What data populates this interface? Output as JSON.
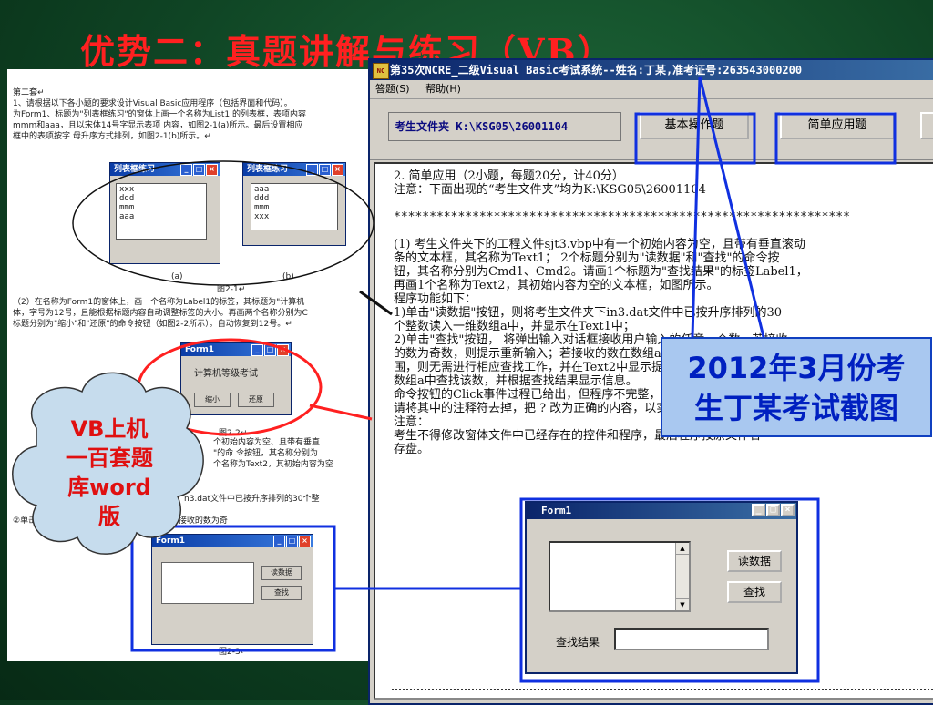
{
  "slide": {
    "title": "优势二：真题讲解与练习（VB）",
    "callout_blue": [
      "2012年3月份考",
      "生丁某考试截图"
    ],
    "cloud_text": [
      "VB上机",
      "一百套题",
      "库word",
      "版"
    ]
  },
  "doc": {
    "lines": [
      "第二套↵",
      "1、请根据以下各小题的要求设计Visual Basic应用程序（包括界面和代码）。",
      "为Form1、标题为\"列表框练习\"的窗体上画一个名称为List1 的列表框，表项内容",
      "mmm和aaa，且以宋体14号字显示表项 内容，如图2-1(a)所示。最后设置相应",
      "框中的表项按字 母升序方式排列，如图2-1(b)所示。↵"
    ],
    "listwin_a_title": "列表框练习",
    "listwin_b_title": "列表框练习",
    "list_a": [
      "xxx",
      "ddd",
      "mmm",
      "aaa"
    ],
    "list_b": [
      "aaa",
      "ddd",
      "mmm",
      "xxx"
    ],
    "fig21_labels": [
      "(a)",
      "(b)"
    ],
    "fig21_caption": "图2-1↵",
    "q2_lines": [
      "（2）在名称为Form1的窗体上，画一个名称为Label1的标签，其标题为\"计算机",
      "体，字号为12号，且能根据标题内容自动调整标签的大小。再画两个名称分别为C",
      "标题分别为\"缩小\"和\"还原\"的命令按钮（如图2-2所示）。自动恢复到12号。↵"
    ],
    "form_mini_title": "Form1",
    "form_mini_label": "计算机等级考试",
    "form_mini_btn1": "缩小",
    "form_mini_btn2": "还原",
    "fig22_caption": "图2-2↵",
    "lower_lines": [
      "个初始内容为空、且带有垂直",
      "\"的命 令按钮，其名称分别为",
      "个名称为Text2，其初始内容为空",
      "n3.dat文件中已按升序排列的30个整",
      "②单击   入框接收用户输入的任意一个调数，若接收的数为奇"
    ],
    "form3_title": "Form1",
    "form3_btn1": "读数据",
    "form3_btn2": "查找",
    "fig23_caption": "图2-3↵"
  },
  "window": {
    "title": "第35次NCRE_二级Visual Basic考试系统--姓名:丁某,准考证号:263543000200",
    "icon_text": "NC",
    "menu": [
      "答题(S)",
      "帮助(H)"
    ],
    "folder_label": "考生文件夹 K:\\KSG05\\26001104",
    "tabs": [
      "基本操作题",
      "简单应用题",
      "综"
    ],
    "content_lines": [
      "2. 简单应用（2小题，每题20分，计40分）",
      "     注意：下面出现的“考生文件夹”均为K:\\KSG05\\26001104",
      "",
      "****************************************************************",
      "",
      "  (1) 考生文件夹下的工程文件sjt3.vbp中有一个初始内容为空，且带有垂直滚动",
      "      条的文本框，其名称为Text1； 2个标题分别为\"读数据\"和\"查找\"的命令按",
      "      钮，其名称分别为Cmd1、Cmd2。请画1个标题为\"查找结果\"的标签Label1，",
      "      再画1个名称为Text2，其初始内容为空的文本框，如图所示。",
      "      程序功能如下：",
      "      1)单击\"读数据\"按钮，则将考生文件夹下in3.dat文件中已按升序排列的30",
      "        个整数读入一维数组a中，并显示在Text1中；",
      "      2)单击\"查找\"按钮， 将弹出输入对话框接收用户输入的任意一个数，若接收",
      "        的数为奇数，则提示重新输入；若接收的数在数组a中的数的范",
      "        围，则无需进行相应查找工作，并在Text2中显示提示信息；否则在",
      "        数组a中查找该数，并根据查找结果显示信息。",
      "      命令按钮的Click事件过程已给出，但程序不完整，",
      "      请将其中的注释符去掉，把 ? 改为正确的内容，以实现上述程序功能。",
      "      注意：",
      "        考生不得修改窗体文件中已经存在的控件和程序，最后程序按原文件名",
      "      存盘。"
    ]
  },
  "form1": {
    "title": "Form1",
    "btn_read": "读数据",
    "btn_find": "查找",
    "result_label": "查找结果",
    "tb_min": "_",
    "tb_max": "□",
    "tb_close": "×"
  },
  "colors": {
    "slide_title": "#ff2020",
    "callout_text": "#0020c0",
    "highlight_box": "#1030e0",
    "cloud_text": "#e01010",
    "red_ring": "#ff2020"
  }
}
